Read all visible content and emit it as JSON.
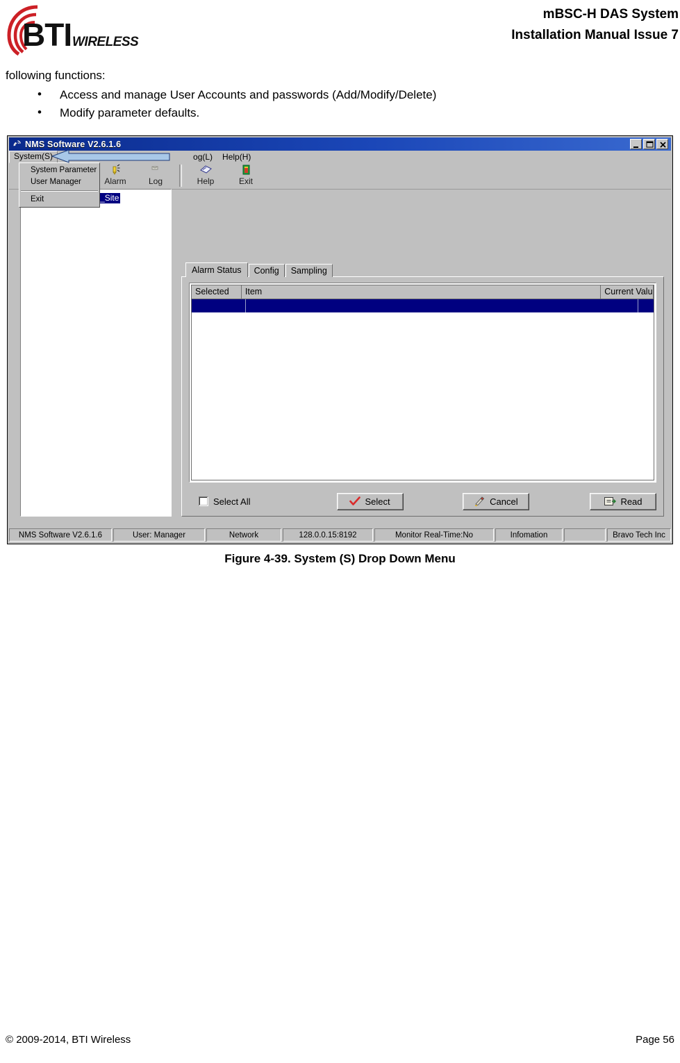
{
  "header": {
    "line1": "mBSC-H DAS System",
    "line2": "Installation Manual Issue 7",
    "logo_text": "BTI",
    "logo_sub": "WIRELESS"
  },
  "body": {
    "intro": "following functions:",
    "bullets": [
      "Access and manage User Accounts and passwords (Add/Modify/Delete)",
      "Modify parameter defaults."
    ]
  },
  "app": {
    "title": "NMS Software V2.6.1.6",
    "window_buttons": {
      "minimize": "minimize-button",
      "maximize": "maximize-button",
      "close": "close-button"
    },
    "menubar": [
      {
        "label": "System(S)",
        "open": true
      },
      {
        "label": "og(L)",
        "open": false
      },
      {
        "label": "Help(H)",
        "open": false
      }
    ],
    "dropdown": {
      "items": [
        {
          "label": "System Parameter",
          "separator_after": false
        },
        {
          "label": "User Manager",
          "separator_after": true
        },
        {
          "label": "Exit",
          "separator_after": false
        }
      ]
    },
    "toolbar": [
      {
        "label": "Alarm",
        "icon": "alarm-icon"
      },
      {
        "label": "Log",
        "icon": "log-icon"
      },
      {
        "label": "Help",
        "icon": "help-icon"
      },
      {
        "label": "Exit",
        "icon": "exit-icon"
      }
    ],
    "tree": {
      "root_label": "BTI_Example_Site",
      "expander": "+"
    },
    "tabs": [
      {
        "label": "Alarm Status",
        "active": true
      },
      {
        "label": "Config",
        "active": false
      },
      {
        "label": "Sampling",
        "active": false
      }
    ],
    "grid": {
      "columns": [
        "Selected",
        "Item",
        "Current Value"
      ],
      "rows": [
        {
          "selected": "",
          "item": "",
          "current_value": "",
          "highlighted": true
        }
      ]
    },
    "controls": {
      "select_all_label": "Select All",
      "select_all_checked": false,
      "buttons": [
        {
          "label": "Select",
          "icon": "check-icon"
        },
        {
          "label": "Cancel",
          "icon": "eraser-icon"
        },
        {
          "label": "Read",
          "icon": "read-icon"
        }
      ]
    },
    "statusbar": [
      "NMS Software V2.6.1.6",
      "User: Manager",
      "Network",
      "128.0.0.15:8192",
      "Monitor Real-Time:No",
      "Infomation",
      "",
      "Bravo Tech Inc"
    ]
  },
  "figure": {
    "caption": "Figure 4-39. System (S) Drop Down Menu"
  },
  "footer": {
    "copyright": "© 2009-2014, BTI Wireless",
    "page": "Page 56"
  },
  "colors": {
    "titlebar_start": "#0a2a8c",
    "titlebar_end": "#3a6ad0",
    "window_face": "#c0c0c0",
    "selection": "#000080",
    "callout_fill": "#a8c8e8",
    "callout_stroke": "#1f3d7a",
    "logo_red": "#cc2026"
  }
}
